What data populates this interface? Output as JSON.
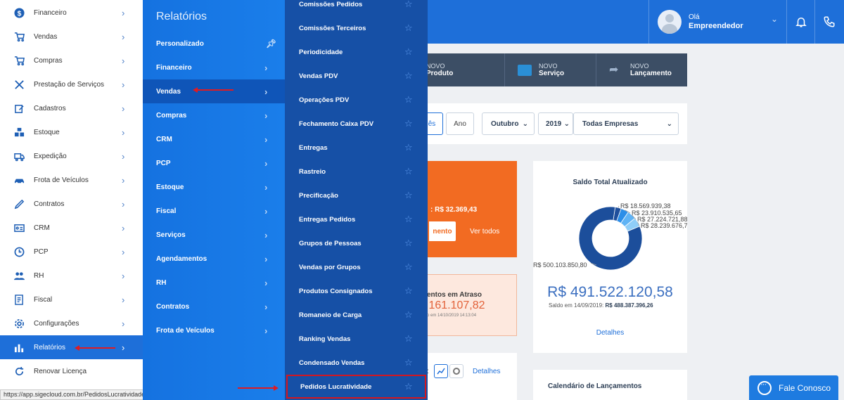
{
  "header": {
    "greeting": "Olá",
    "user_name": "Empreendedor",
    "bell_icon": "bell-icon",
    "phone_icon": "phone-icon"
  },
  "quick_actions": [
    {
      "small": "NOVO",
      "label": "Produto",
      "icon": "box-icon"
    },
    {
      "small": "NOVO",
      "label": "Serviço",
      "icon": "briefcase-icon"
    },
    {
      "small": "NOVO",
      "label": "Lançamento",
      "icon": "share-arrow-icon"
    }
  ],
  "filters": {
    "partial_button": "ês",
    "year_button": "Ano",
    "month": "Outubro",
    "year": "2019",
    "company": "Todas Empresas"
  },
  "orange_card": {
    "total_text": ": R$ 32.369,43",
    "button_label": "nento",
    "view_all": "Ver todos"
  },
  "overdue_card": {
    "title": "entos em Atraso",
    "value": ".161.107,82",
    "subtext": "o em 14/10/2019 14:13:04"
  },
  "graph_card": {
    "prefix": ":",
    "details": "Detalhes"
  },
  "saldo_card": {
    "title": "Saldo Total Atualizado",
    "labels": [
      "R$ 18.569.939,38",
      "R$ 23.910.535,65",
      "R$ 27.224.721,88",
      "R$ 28.239.676,7",
      "R$ 500.103.850,80"
    ],
    "values": [
      18569939.38,
      23910535.65,
      27224721.88,
      28239676.7,
      500103850.8
    ],
    "colors": [
      "#1f4f9c",
      "#2c8ee8",
      "#5fb3f5",
      "#8fcdf8",
      "#1c4e9b"
    ],
    "total": "R$ 491.522.120,58",
    "sub_prefix": "Saldo em 14/09/2019:",
    "sub_value": "R$ 488.387.396,26",
    "details": "Detalhes"
  },
  "calendar_card": {
    "title": "Calendário de Lançamentos"
  },
  "fale_conosco": "Fale Conosco",
  "status_url": "https://app.sigecloud.com.br/PedidosLucratividade/Report",
  "sidebar": {
    "items": [
      {
        "label": "Financeiro",
        "icon": "dollar-icon"
      },
      {
        "label": "Vendas",
        "icon": "cart-icon"
      },
      {
        "label": "Compras",
        "icon": "cart-icon"
      },
      {
        "label": "Prestação de Serviços",
        "icon": "tools-icon"
      },
      {
        "label": "Cadastros",
        "icon": "edit-icon"
      },
      {
        "label": "Estoque",
        "icon": "boxes-icon"
      },
      {
        "label": "Expedição",
        "icon": "truck-icon"
      },
      {
        "label": "Frota de Veículos",
        "icon": "car-icon"
      },
      {
        "label": "Contratos",
        "icon": "pen-icon"
      },
      {
        "label": "CRM",
        "icon": "id-card-icon"
      },
      {
        "label": "PCP",
        "icon": "clock-icon"
      },
      {
        "label": "RH",
        "icon": "users-icon"
      },
      {
        "label": "Fiscal",
        "icon": "document-icon"
      },
      {
        "label": "Configurações",
        "icon": "gear-icon"
      },
      {
        "label": "Relatórios",
        "icon": "bar-chart-icon"
      },
      {
        "label": "Renovar Licença",
        "icon": "refresh-icon"
      }
    ]
  },
  "reports_panel": {
    "title": "Relatórios",
    "items": [
      {
        "label": "Personalizado"
      },
      {
        "label": "Financeiro"
      },
      {
        "label": "Vendas"
      },
      {
        "label": "Compras"
      },
      {
        "label": "CRM"
      },
      {
        "label": "PCP"
      },
      {
        "label": "Estoque"
      },
      {
        "label": "Fiscal"
      },
      {
        "label": "Serviços"
      },
      {
        "label": "Agendamentos"
      },
      {
        "label": "RH"
      },
      {
        "label": "Contratos"
      },
      {
        "label": "Frota de Veículos"
      }
    ]
  },
  "sales_reports": {
    "items": [
      {
        "label": "Comissões Pedidos"
      },
      {
        "label": "Comissões Terceiros"
      },
      {
        "label": "Periodicidade"
      },
      {
        "label": "Vendas PDV"
      },
      {
        "label": "Operações PDV"
      },
      {
        "label": "Fechamento Caixa PDV"
      },
      {
        "label": "Entregas"
      },
      {
        "label": "Rastreio"
      },
      {
        "label": "Precificação"
      },
      {
        "label": "Entregas Pedidos"
      },
      {
        "label": "Grupos de Pessoas"
      },
      {
        "label": "Vendas por Grupos"
      },
      {
        "label": "Produtos Consignados"
      },
      {
        "label": "Romaneio de Carga"
      },
      {
        "label": "Ranking Vendas"
      },
      {
        "label": "Condensado Vendas"
      },
      {
        "label": "Pedidos Lucratividade"
      }
    ]
  }
}
